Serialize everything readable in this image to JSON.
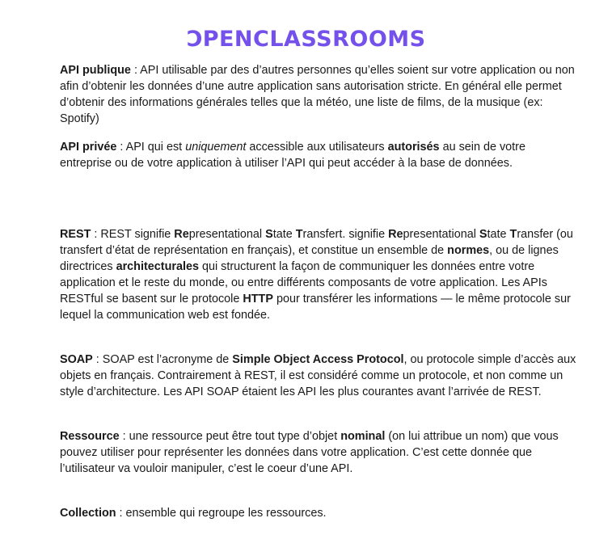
{
  "brand": {
    "logo_first": "C",
    "logo_rest": "PENCLASSROOMS",
    "logo_color": "#7451eb"
  },
  "paragraphs": [
    {
      "id": "api-publique",
      "segments": [
        {
          "t": "API publique",
          "b": true
        },
        {
          "t": " : API utilisable par des d’autres personnes qu’elles soient sur votre application ou non afin d’obtenir les données d’une autre application sans autorisation stricte. En général elle permet d’obtenir des informations générales telles que la météo, une liste de films, de la musique (ex: Spotify)"
        }
      ]
    },
    {
      "id": "api-privee",
      "segments": [
        {
          "t": "API privée",
          "b": true
        },
        {
          "t": " : API qui est "
        },
        {
          "t": "uniquement",
          "i": true
        },
        {
          "t": " accessible aux utilisateurs "
        },
        {
          "t": "autorisés",
          "b": true
        },
        {
          "t": " au sein de votre entreprise ou de votre application à utiliser l’API qui peut accéder à la base de données."
        }
      ]
    },
    {
      "id": "rest",
      "segments": [
        {
          "t": "REST",
          "b": true
        },
        {
          "t": " : REST signifie "
        },
        {
          "t": "Re",
          "b": true
        },
        {
          "t": "presentational "
        },
        {
          "t": "S",
          "b": true
        },
        {
          "t": "tate "
        },
        {
          "t": "T",
          "b": true
        },
        {
          "t": "ransfert.  signifie "
        },
        {
          "t": "Re",
          "b": true
        },
        {
          "t": "presentational "
        },
        {
          "t": "S",
          "b": true
        },
        {
          "t": "tate "
        },
        {
          "t": "T",
          "b": true
        },
        {
          "t": "ransfer (ou transfert d’état de représentation en français), et constitue un ensemble de "
        },
        {
          "t": "normes",
          "b": true
        },
        {
          "t": ", ou de lignes directrices "
        },
        {
          "t": "architecturales",
          "b": true
        },
        {
          "t": " qui structurent la façon de communiquer les données entre votre application et le reste du monde, ou entre différents composants de votre application. Les APIs RESTful se basent sur le protocole "
        },
        {
          "t": "HTTP",
          "b": true
        },
        {
          "t": " pour transférer les informations — le même protocole sur lequel la communication web est fondée."
        }
      ]
    },
    {
      "id": "soap",
      "segments": [
        {
          "t": "SOAP",
          "b": true
        },
        {
          "t": " : SOAP est l’acronyme de "
        },
        {
          "t": "Simple Object Access Protocol",
          "b": true
        },
        {
          "t": ", ou protocole simple d’accès aux objets en français. Contrairement à REST, il est considéré comme un protocole, et non comme un style d’architecture. Les API SOAP étaient les API les plus courantes avant l’arrivée de REST."
        }
      ]
    },
    {
      "id": "ressource",
      "segments": [
        {
          "t": "Ressource",
          "b": true
        },
        {
          "t": " : une ressource peut être tout type d’objet "
        },
        {
          "t": "nominal",
          "b": true
        },
        {
          "t": " (on lui attribue un nom) que vous pouvez utiliser pour représenter les données dans votre application. C’est cette donnée que l’utilisateur va vouloir manipuler, c’est le coeur d’une API."
        }
      ]
    },
    {
      "id": "collection",
      "segments": [
        {
          "t": "Collection",
          "b": true
        },
        {
          "t": " : ensemble qui regroupe les ressources."
        }
      ]
    }
  ]
}
